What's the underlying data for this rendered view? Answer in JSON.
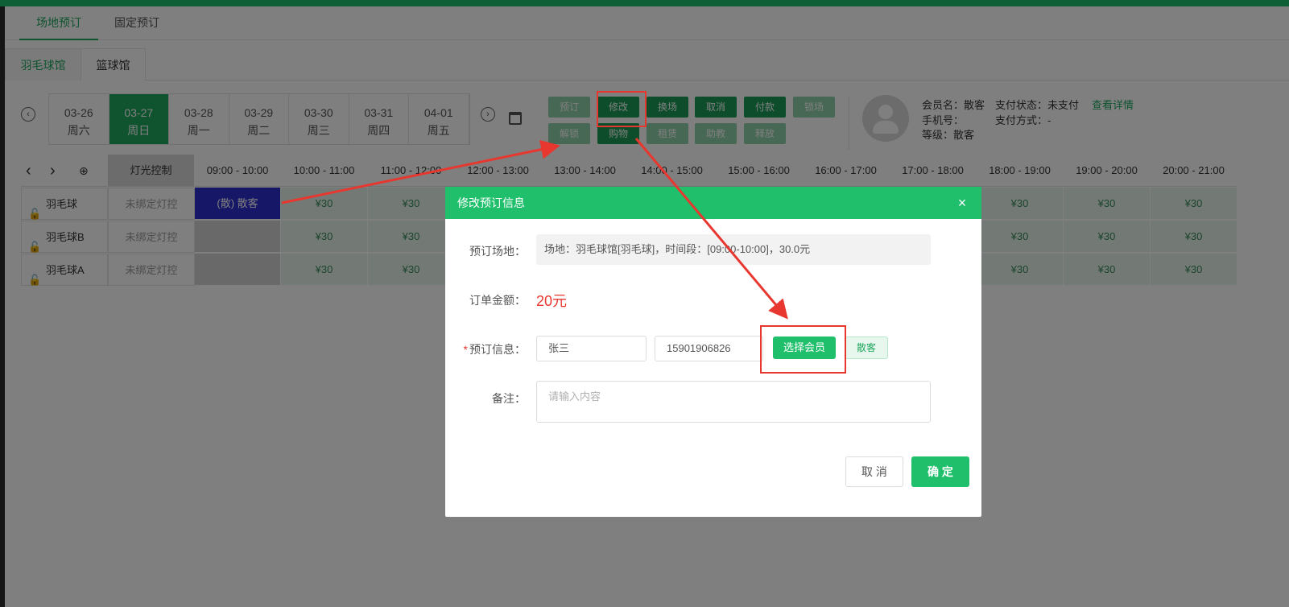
{
  "tabs": [
    "场地预订",
    "固定预订"
  ],
  "venue_tabs": [
    "羽毛球馆",
    "篮球馆"
  ],
  "dates": [
    {
      "date": "03-26",
      "weekday": "周六"
    },
    {
      "date": "03-27",
      "weekday": "周日"
    },
    {
      "date": "03-28",
      "weekday": "周一"
    },
    {
      "date": "03-29",
      "weekday": "周二"
    },
    {
      "date": "03-30",
      "weekday": "周三"
    },
    {
      "date": "03-31",
      "weekday": "周四"
    },
    {
      "date": "04-01",
      "weekday": "周五"
    }
  ],
  "actions": {
    "row1": [
      "预订",
      "修改",
      "换场",
      "取消",
      "付款",
      "锁场"
    ],
    "row2": [
      "解锁",
      "购物",
      "租赁",
      "助教",
      "释放"
    ]
  },
  "member": {
    "name_label": "会员名：",
    "name_value": "散客",
    "pay_status_label": "支付状态：",
    "pay_status_value": "未支付",
    "detail_link": "查看详情",
    "phone_label": "手机号：",
    "pay_method_label": "支付方式：",
    "pay_method_value": "-",
    "level_label": "等级：",
    "level_value": "散客"
  },
  "grid": {
    "light_header": "灯光控制",
    "times": [
      "09:00 - 10:00",
      "10:00 - 11:00",
      "11:00 - 12:00",
      "12:00 - 13:00",
      "13:00 - 14:00",
      "14:00 - 15:00",
      "15:00 - 16:00",
      "16:00 - 17:00",
      "17:00 - 18:00",
      "18:00 - 19:00",
      "19:00 - 20:00",
      "20:00 - 21:00"
    ],
    "courts": [
      "羽毛球",
      "羽毛球B",
      "羽毛球A"
    ],
    "light_status": "未绑定灯控",
    "booked_label": "(散) 散客",
    "price": "¥30"
  },
  "modal": {
    "title": "修改预订信息",
    "venue_label": "预订场地：",
    "venue_value": "场地：羽毛球馆[羽毛球]，时间段：[09:00-10:00]，30.0元",
    "amount_label": "订单金额：",
    "amount_value": "20元",
    "info_label": "预订信息：",
    "req_mark": "*",
    "name_value": "张三",
    "phone_value": "15901906826",
    "select_member": "选择会员",
    "guest": "散客",
    "remark_label": "备注：",
    "remark_placeholder": "请输入内容",
    "cancel": "取 消",
    "confirm": "确 定"
  },
  "colors": {
    "accent": "#1fbf6c",
    "annotation": "#e8372f"
  }
}
